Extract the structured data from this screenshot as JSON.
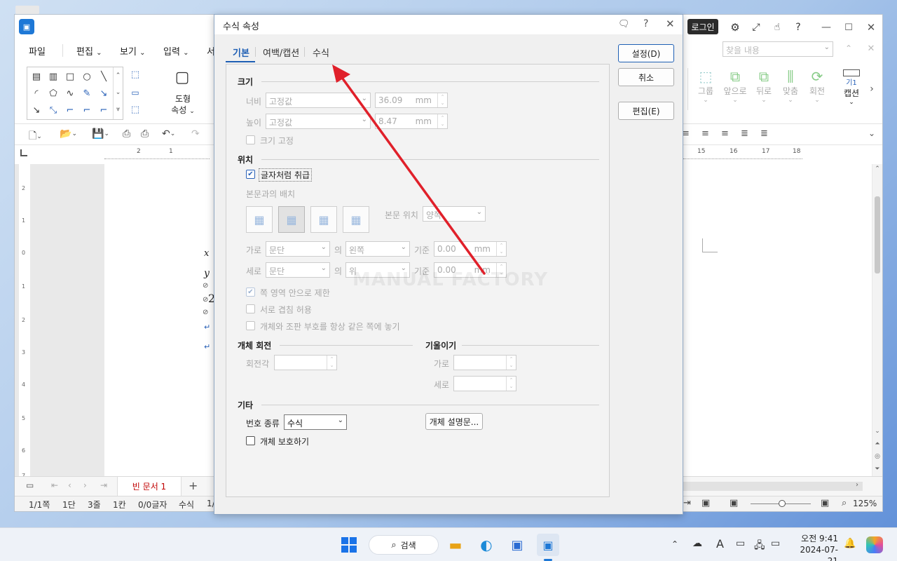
{
  "app": {
    "menu": [
      "파일",
      "편집",
      "보기",
      "입력",
      "서"
    ],
    "login_label": "로그인",
    "ribbon": {
      "shape_props_line1": "도형",
      "shape_props_line2": "속성",
      "group": "그룹",
      "front": "앞으로",
      "back": "뒤로",
      "align": "맞춤",
      "rotate": "회전",
      "caption": "캡션",
      "caption_icon_text": "기1",
      "search_placeholder": "찾을 내용"
    },
    "ruler_left_ticks": [
      "2",
      "1"
    ],
    "ruler_right_ticks": [
      "15",
      "16",
      "17",
      "18"
    ],
    "vruler_ticks": [
      "2",
      "1",
      "0",
      "1",
      "2",
      "3",
      "4",
      "5",
      "6",
      "7"
    ],
    "doc_tab": "빈 문서 1",
    "status": {
      "page": "1/1쪽",
      "section": "1단",
      "line": "3줄",
      "column": "1칸",
      "chars": "0/0글자",
      "mode": "수식",
      "more": "1/",
      "zoom": "125%"
    },
    "formula_glyphs": [
      "x",
      "y",
      "2"
    ]
  },
  "dialog": {
    "title": "수식 속성",
    "tabs": [
      "기본",
      "여백/캡션",
      "수식"
    ],
    "buttons": {
      "ok": "설정(D)",
      "cancel": "취소",
      "edit": "편집(E)"
    },
    "size": {
      "section": "크기",
      "width_label": "너비",
      "width_mode": "고정값",
      "width_value": "36.09",
      "width_unit": "mm",
      "height_label": "높이",
      "height_mode": "고정값",
      "height_value": "8.47",
      "height_unit": "mm",
      "fix_size": "크기 고정"
    },
    "position": {
      "section": "위치",
      "treat_as_char": "글자처럼 취급",
      "wrap_label": "본문과의 배치",
      "text_pos_label": "본문 위치",
      "text_pos_value": "양쪽",
      "horiz_label": "가로",
      "horiz_rel": "문단",
      "of": "의",
      "horiz_align": "왼쪽",
      "basis": "기준",
      "horiz_value": "0.00",
      "vert_label": "세로",
      "vert_rel": "문단",
      "vert_align": "위",
      "vert_value": "0.00",
      "unit": "mm",
      "limit_page": "쪽 영역 안으로 제한",
      "allow_overlap": "서로 겹침 허용",
      "same_page": "개체와 조판 부호를 항상 같은 쪽에 놓기"
    },
    "rotation": {
      "section": "개체 회전",
      "angle_label": "회전각"
    },
    "skew": {
      "section": "기울이기",
      "horiz_label": "가로",
      "vert_label": "세로"
    },
    "misc": {
      "section": "기타",
      "number_type_label": "번호 종류",
      "number_type_value": "수식",
      "description_button": "개체 설명문...",
      "protect": "개체 보호하기"
    },
    "watermark": "MANUAL FACTORY"
  },
  "taskbar": {
    "search_label": "검색",
    "time": "오전 9:41",
    "date": "2024-07-21",
    "ime": "A"
  },
  "colors": {
    "accent": "#1e78d6",
    "arrow": "#e0202a",
    "tab_active": "#c00000"
  }
}
